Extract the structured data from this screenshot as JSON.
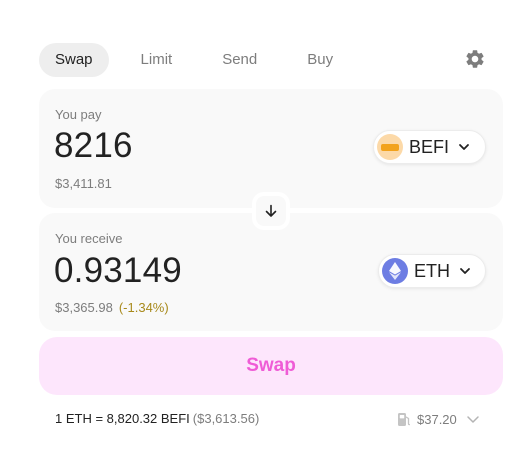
{
  "tabs": [
    {
      "label": "Swap",
      "active": true
    },
    {
      "label": "Limit",
      "active": false
    },
    {
      "label": "Send",
      "active": false
    },
    {
      "label": "Buy",
      "active": false
    }
  ],
  "settings_icon": "gear-icon",
  "pay": {
    "label": "You pay",
    "amount": "8216",
    "usd": "$3,411.81",
    "token": {
      "symbol": "BEFI",
      "icon": "befi-token-icon",
      "color": "#f2a21c"
    }
  },
  "receive": {
    "label": "You receive",
    "amount": "0.93149",
    "usd": "$3,365.98",
    "change": "(-1.34%)",
    "token": {
      "symbol": "ETH",
      "icon": "eth-token-icon",
      "color": "#6d7de3"
    }
  },
  "switch_icon": "arrow-down-icon",
  "swap_button": {
    "label": "Swap",
    "text_color": "#ef5cd6",
    "bg_color": "#fde6fc"
  },
  "rate": {
    "text": "1 ETH = 8,820.32 BEFI",
    "usd": "($3,613.56)"
  },
  "gas": {
    "icon": "fuel-pump-icon",
    "value": "$37.20"
  },
  "colors": {
    "warning": "#a88a1c",
    "muted": "#7d7d7d"
  }
}
